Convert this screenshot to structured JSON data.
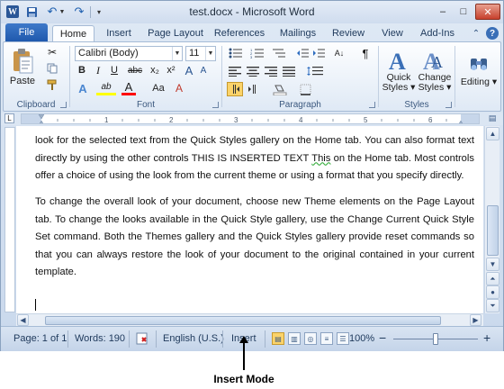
{
  "window": {
    "title": "test.docx - Microsoft Word",
    "controls": {
      "minimize": "–",
      "maximize": "□",
      "close": "✕"
    }
  },
  "quick_access": {
    "icons": [
      "word-logo-icon",
      "save-icon",
      "undo-icon",
      "redo-icon",
      "customize-icon"
    ],
    "logo_letter": "W"
  },
  "tabs": {
    "file": "File",
    "items": [
      "Home",
      "Insert",
      "Page Layout",
      "References",
      "Mailings",
      "Review",
      "View",
      "Add-Ins"
    ],
    "active": "Home"
  },
  "ribbon": {
    "clipboard": {
      "label": "Clipboard",
      "paste": "Paste"
    },
    "font": {
      "label": "Font",
      "family": "Calibri (Body)",
      "size": "11",
      "buttons": {
        "bold": "B",
        "italic": "I",
        "underline": "U",
        "strike": "abc",
        "subscript": "x₂",
        "superscript": "x²",
        "grow": "A",
        "shrink": "A",
        "change_case": "Aa",
        "clear": "A",
        "effects": "A",
        "highlight": "ab",
        "color": "A"
      },
      "colors": {
        "highlight": "#ffff00",
        "font": "#ff0000"
      }
    },
    "paragraph": {
      "label": "Paragraph",
      "pilcrow": "¶"
    },
    "styles": {
      "label": "Styles",
      "quick_styles": [
        "Quick",
        "Styles ▾"
      ],
      "change_styles": [
        "Change",
        "Styles ▾"
      ]
    },
    "editing": {
      "label": "Editing ▾"
    }
  },
  "document": {
    "paragraphs": [
      {
        "before": "look for the selected text from the Quick Styles gallery on the Home tab. You can also format text directly by using the other controls THIS IS INSERTED TEXT ",
        "marked": "This",
        "after": " on the Home tab. Most controls offer a choice of using the look from the current theme or using a format that you specify directly."
      },
      {
        "before": "To change the overall look of your document, choose new Theme elements on the Page Layout tab. To change the looks available in the Quick Style gallery, use the Change Current Quick Style Set command. Both the Themes gallery and the Quick Styles gallery provide reset commands so that you can always restore the look of your document to the original contained in your current template.",
        "marked": "",
        "after": ""
      }
    ]
  },
  "status_bar": {
    "page": "Page: 1 of 1",
    "words": "Words: 190",
    "language": "English (U.S.)",
    "mode": "Insert",
    "zoom": "100%",
    "zoom_out": "−",
    "zoom_in": "+",
    "zoom_level": 0.5
  },
  "annotation": {
    "label": "Insert Mode"
  }
}
